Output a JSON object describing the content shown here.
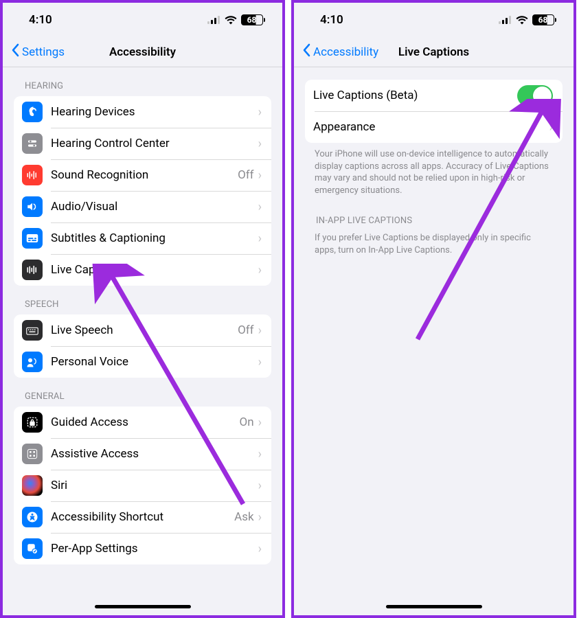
{
  "left": {
    "time": "4:10",
    "battery": "68",
    "back": "Settings",
    "title": "Accessibility",
    "sections": {
      "hearing": {
        "header": "HEARING",
        "items": [
          {
            "label": "Hearing Devices",
            "value": "",
            "icon": "ear-icon",
            "bg": "bg-blue"
          },
          {
            "label": "Hearing Control Center",
            "value": "",
            "icon": "sliders-icon",
            "bg": "bg-gray"
          },
          {
            "label": "Sound Recognition",
            "value": "Off",
            "icon": "wave-icon",
            "bg": "bg-red"
          },
          {
            "label": "Audio/Visual",
            "value": "",
            "icon": "speaker-icon",
            "bg": "bg-blue"
          },
          {
            "label": "Subtitles & Captioning",
            "value": "",
            "icon": "captions-icon",
            "bg": "bg-blue"
          },
          {
            "label": "Live Captions",
            "value": "",
            "icon": "livecaptions-icon",
            "bg": "bg-dark"
          }
        ]
      },
      "speech": {
        "header": "SPEECH",
        "items": [
          {
            "label": "Live Speech",
            "value": "Off",
            "icon": "keyboard-icon",
            "bg": "bg-dark"
          },
          {
            "label": "Personal Voice",
            "value": "",
            "icon": "voice-icon",
            "bg": "bg-blue"
          }
        ]
      },
      "general": {
        "header": "GENERAL",
        "items": [
          {
            "label": "Guided Access",
            "value": "On",
            "icon": "lock-icon",
            "bg": "bg-black"
          },
          {
            "label": "Assistive Access",
            "value": "",
            "icon": "grid-icon",
            "bg": "bg-gray"
          },
          {
            "label": "Siri",
            "value": "",
            "icon": "siri-icon",
            "bg": "bg-siri"
          },
          {
            "label": "Accessibility Shortcut",
            "value": "Ask",
            "icon": "shortcut-icon",
            "bg": "bg-blue"
          },
          {
            "label": "Per-App Settings",
            "value": "",
            "icon": "perapp-icon",
            "bg": "bg-blue"
          }
        ]
      }
    }
  },
  "right": {
    "time": "4:10",
    "battery": "68",
    "back": "Accessibility",
    "title": "Live Captions",
    "rows": {
      "toggle_label": "Live Captions (Beta)",
      "appearance_label": "Appearance"
    },
    "footer1": "Your iPhone will use on-device intelligence to automatically display captions across all apps. Accuracy of Live Captions may vary and should not be relied upon in high-risk or emergency situations.",
    "section2_header": "IN-APP LIVE CAPTIONS",
    "footer2": "If you prefer Live Captions be displayed only in specific apps, turn on In-App Live Captions."
  }
}
